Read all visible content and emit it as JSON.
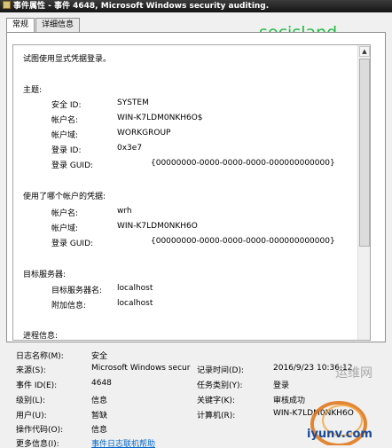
{
  "window": {
    "title": "事件属性 - 事件 4648, Microsoft Windows security auditing."
  },
  "tabs": [
    {
      "label": "常规"
    },
    {
      "label": "详细信息"
    }
  ],
  "watermark": "secisland",
  "description": {
    "intro": "试图使用显式凭据登录。",
    "subject_heading": "主题:",
    "subject": [
      {
        "label": "安全 ID:",
        "value": "SYSTEM"
      },
      {
        "label": "帐户名:",
        "value": "WIN-K7LDM0NKH6O$"
      },
      {
        "label": "帐户域:",
        "value": "WORKGROUP"
      },
      {
        "label": "登录 ID:",
        "value": "0x3e7"
      },
      {
        "label": "登录 GUID:",
        "value": "{00000000-0000-0000-0000-000000000000}"
      }
    ],
    "creds_heading": "使用了哪个帐户的凭据:",
    "creds": [
      {
        "label": "帐户名:",
        "value": "wrh"
      },
      {
        "label": "帐户域:",
        "value": "WIN-K7LDM0NKH6O"
      },
      {
        "label": "登录 GUID:",
        "value": "{00000000-0000-0000-0000-000000000000}"
      }
    ],
    "target_heading": "目标服务器:",
    "target": [
      {
        "label": "目标服务器名:",
        "value": "localhost"
      },
      {
        "label": "附加信息:",
        "value": "localhost"
      }
    ],
    "process_heading": "进程信息:"
  },
  "properties": {
    "log_name": {
      "label": "日志名称(M):",
      "value": "安全"
    },
    "source": {
      "label": "来源(S):",
      "value": "Microsoft Windows secur"
    },
    "logged": {
      "label": "记录时间(D):",
      "value": "2016/9/23 10:36:12"
    },
    "event_id": {
      "label": "事件 ID(E):",
      "value": "4648"
    },
    "task_category": {
      "label": "任务类别(Y):",
      "value": "登录"
    },
    "level": {
      "label": "级别(L):",
      "value": "信息"
    },
    "keywords": {
      "label": "关键字(K):",
      "value": "审核成功"
    },
    "user": {
      "label": "用户(U):",
      "value": "暂缺"
    },
    "computer": {
      "label": "计算机(R):",
      "value": "WIN-K7LDM0NKH6O"
    },
    "opcode": {
      "label": "操作代码(O):",
      "value": "信息"
    },
    "more_info": {
      "label": "更多信息(I):",
      "value": "事件日志联机帮助"
    }
  },
  "badge": {
    "text": "iyunv.com",
    "text_cn": "运维网"
  },
  "icons": {
    "title": "event-window-icon",
    "scroll_up": "scroll-up-arrow-icon",
    "scroll_down": "scroll-down-arrow-icon"
  }
}
